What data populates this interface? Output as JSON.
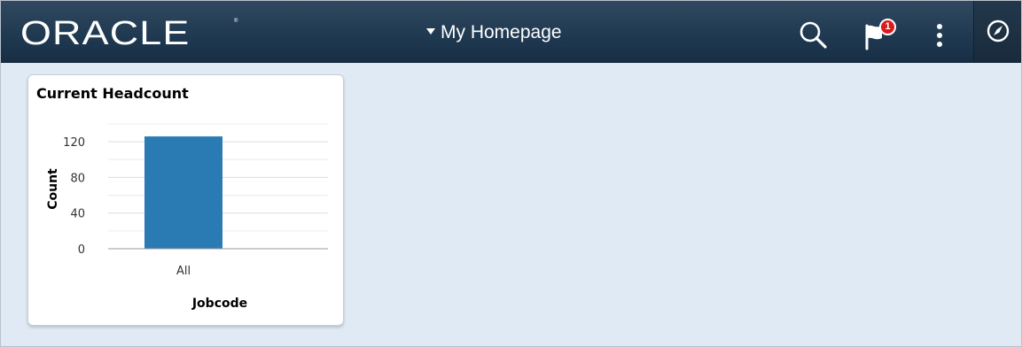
{
  "header": {
    "logo_text": "ORACLE",
    "logo_mark": "®",
    "page_title": "My Homepage",
    "search_icon": "search-icon",
    "notifications_icon": "flag-icon",
    "notifications_count": "1",
    "actions_icon": "more-vertical-icon",
    "navbar_icon": "compass-icon"
  },
  "colors": {
    "banner": "#203a52",
    "background": "#dfeaf5",
    "bar": "#2a7bb4",
    "badge": "#d91b1b"
  },
  "tile": {
    "title": "Current Headcount"
  },
  "chart_data": {
    "type": "bar",
    "title": "",
    "categories": [
      "All"
    ],
    "values": [
      126
    ],
    "xlabel": "Jobcode",
    "ylabel": "Count",
    "yticks": [
      0,
      40,
      80,
      120
    ],
    "ylim": [
      0,
      140
    ],
    "grid": true,
    "legend": "none"
  }
}
